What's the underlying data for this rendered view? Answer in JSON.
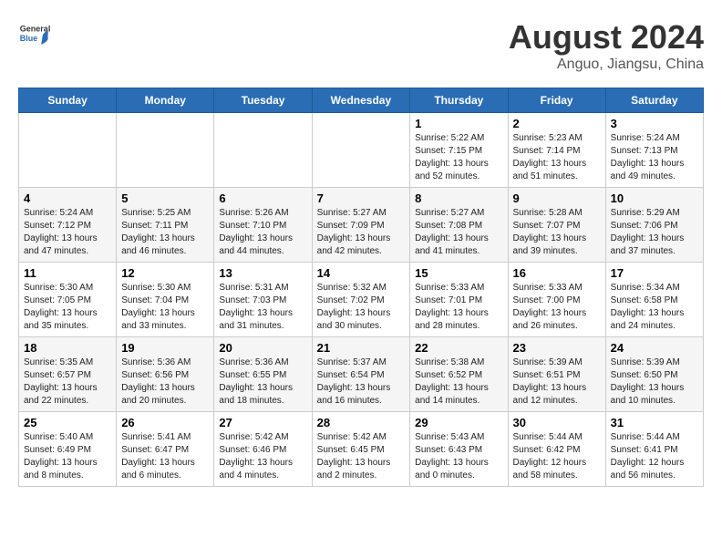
{
  "header": {
    "logo_general": "General",
    "logo_blue": "Blue",
    "month_title": "August 2024",
    "location": "Anguo, Jiangsu, China"
  },
  "weekdays": [
    "Sunday",
    "Monday",
    "Tuesday",
    "Wednesday",
    "Thursday",
    "Friday",
    "Saturday"
  ],
  "weeks": [
    [
      {
        "day": "",
        "info": ""
      },
      {
        "day": "",
        "info": ""
      },
      {
        "day": "",
        "info": ""
      },
      {
        "day": "",
        "info": ""
      },
      {
        "day": "1",
        "info": "Sunrise: 5:22 AM\nSunset: 7:15 PM\nDaylight: 13 hours\nand 52 minutes."
      },
      {
        "day": "2",
        "info": "Sunrise: 5:23 AM\nSunset: 7:14 PM\nDaylight: 13 hours\nand 51 minutes."
      },
      {
        "day": "3",
        "info": "Sunrise: 5:24 AM\nSunset: 7:13 PM\nDaylight: 13 hours\nand 49 minutes."
      }
    ],
    [
      {
        "day": "4",
        "info": "Sunrise: 5:24 AM\nSunset: 7:12 PM\nDaylight: 13 hours\nand 47 minutes."
      },
      {
        "day": "5",
        "info": "Sunrise: 5:25 AM\nSunset: 7:11 PM\nDaylight: 13 hours\nand 46 minutes."
      },
      {
        "day": "6",
        "info": "Sunrise: 5:26 AM\nSunset: 7:10 PM\nDaylight: 13 hours\nand 44 minutes."
      },
      {
        "day": "7",
        "info": "Sunrise: 5:27 AM\nSunset: 7:09 PM\nDaylight: 13 hours\nand 42 minutes."
      },
      {
        "day": "8",
        "info": "Sunrise: 5:27 AM\nSunset: 7:08 PM\nDaylight: 13 hours\nand 41 minutes."
      },
      {
        "day": "9",
        "info": "Sunrise: 5:28 AM\nSunset: 7:07 PM\nDaylight: 13 hours\nand 39 minutes."
      },
      {
        "day": "10",
        "info": "Sunrise: 5:29 AM\nSunset: 7:06 PM\nDaylight: 13 hours\nand 37 minutes."
      }
    ],
    [
      {
        "day": "11",
        "info": "Sunrise: 5:30 AM\nSunset: 7:05 PM\nDaylight: 13 hours\nand 35 minutes."
      },
      {
        "day": "12",
        "info": "Sunrise: 5:30 AM\nSunset: 7:04 PM\nDaylight: 13 hours\nand 33 minutes."
      },
      {
        "day": "13",
        "info": "Sunrise: 5:31 AM\nSunset: 7:03 PM\nDaylight: 13 hours\nand 31 minutes."
      },
      {
        "day": "14",
        "info": "Sunrise: 5:32 AM\nSunset: 7:02 PM\nDaylight: 13 hours\nand 30 minutes."
      },
      {
        "day": "15",
        "info": "Sunrise: 5:33 AM\nSunset: 7:01 PM\nDaylight: 13 hours\nand 28 minutes."
      },
      {
        "day": "16",
        "info": "Sunrise: 5:33 AM\nSunset: 7:00 PM\nDaylight: 13 hours\nand 26 minutes."
      },
      {
        "day": "17",
        "info": "Sunrise: 5:34 AM\nSunset: 6:58 PM\nDaylight: 13 hours\nand 24 minutes."
      }
    ],
    [
      {
        "day": "18",
        "info": "Sunrise: 5:35 AM\nSunset: 6:57 PM\nDaylight: 13 hours\nand 22 minutes."
      },
      {
        "day": "19",
        "info": "Sunrise: 5:36 AM\nSunset: 6:56 PM\nDaylight: 13 hours\nand 20 minutes."
      },
      {
        "day": "20",
        "info": "Sunrise: 5:36 AM\nSunset: 6:55 PM\nDaylight: 13 hours\nand 18 minutes."
      },
      {
        "day": "21",
        "info": "Sunrise: 5:37 AM\nSunset: 6:54 PM\nDaylight: 13 hours\nand 16 minutes."
      },
      {
        "day": "22",
        "info": "Sunrise: 5:38 AM\nSunset: 6:52 PM\nDaylight: 13 hours\nand 14 minutes."
      },
      {
        "day": "23",
        "info": "Sunrise: 5:39 AM\nSunset: 6:51 PM\nDaylight: 13 hours\nand 12 minutes."
      },
      {
        "day": "24",
        "info": "Sunrise: 5:39 AM\nSunset: 6:50 PM\nDaylight: 13 hours\nand 10 minutes."
      }
    ],
    [
      {
        "day": "25",
        "info": "Sunrise: 5:40 AM\nSunset: 6:49 PM\nDaylight: 13 hours\nand 8 minutes."
      },
      {
        "day": "26",
        "info": "Sunrise: 5:41 AM\nSunset: 6:47 PM\nDaylight: 13 hours\nand 6 minutes."
      },
      {
        "day": "27",
        "info": "Sunrise: 5:42 AM\nSunset: 6:46 PM\nDaylight: 13 hours\nand 4 minutes."
      },
      {
        "day": "28",
        "info": "Sunrise: 5:42 AM\nSunset: 6:45 PM\nDaylight: 13 hours\nand 2 minutes."
      },
      {
        "day": "29",
        "info": "Sunrise: 5:43 AM\nSunset: 6:43 PM\nDaylight: 13 hours\nand 0 minutes."
      },
      {
        "day": "30",
        "info": "Sunrise: 5:44 AM\nSunset: 6:42 PM\nDaylight: 12 hours\nand 58 minutes."
      },
      {
        "day": "31",
        "info": "Sunrise: 5:44 AM\nSunset: 6:41 PM\nDaylight: 12 hours\nand 56 minutes."
      }
    ]
  ]
}
